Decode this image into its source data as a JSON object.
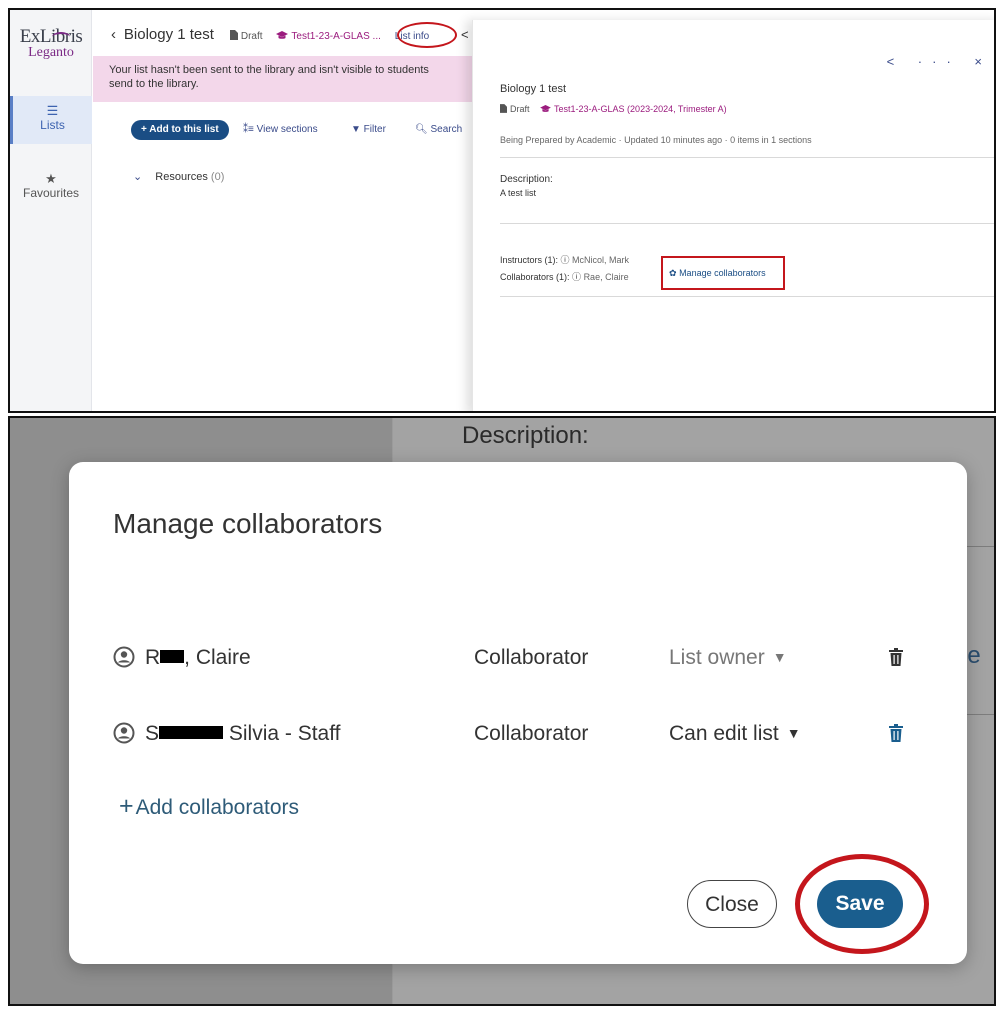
{
  "sidebar": {
    "logo_top": "ExLibris",
    "logo_bottom": "Leganto",
    "items": [
      {
        "icon": "list-icon",
        "glyph": "☰",
        "label": "Lists"
      },
      {
        "icon": "star-icon",
        "glyph": "★",
        "label": "Favourites"
      }
    ]
  },
  "header": {
    "back_glyph": "‹",
    "title": "Biology 1 test",
    "status": "Draft",
    "course": "Test1-23-A-GLAS ...",
    "list_info": "List info",
    "share_glyph": "<"
  },
  "banner": {
    "line1": "Your list hasn't been sent to the library and isn't visible to students",
    "line2": "send to the library."
  },
  "toolbar": {
    "add": "+ Add to this list",
    "view_sections": "⁑≡ View sections",
    "filter": "▼ Filter",
    "search": "🔍︎ Search"
  },
  "resources": {
    "label": "Resources",
    "count": "(0)"
  },
  "info_panel": {
    "actions": "< ··· ×",
    "title": "Biology 1 test",
    "status": "Draft",
    "course": "Test1-23-A-GLAS (2023-2024, Trimester A)",
    "meta": "Being Prepared by Academic  ·  Updated 10 minutes ago  ·  0 items in 1 sections",
    "description_label": "Description:",
    "description": "A test list",
    "instructors_label": "Instructors (1):",
    "instructor": "McNicol, Mark",
    "collaborators_label": "Collaborators (1):",
    "collaborator": "Rae, Claire",
    "manage_link": "Manage collaborators"
  },
  "background": {
    "description": "Description:",
    "snippet": "ge c"
  },
  "modal": {
    "title": "Manage collaborators",
    "rows": [
      {
        "name_prefix": "R",
        "name_suffix": ", Claire",
        "role": "Collaborator",
        "permission": "List owner",
        "trash_enabled": false
      },
      {
        "name_prefix": "S",
        "name_suffix": " Silvia - Staff",
        "role": "Collaborator",
        "permission": "Can edit list",
        "trash_enabled": true
      }
    ],
    "add_label": "Add collaborators",
    "close_label": "Close",
    "save_label": "Save"
  },
  "colors": {
    "brand_purple": "#7b2a86",
    "primary_blue": "#1a5e8e",
    "annotation_red": "#c4161c",
    "banner_pink": "#f3d7ea",
    "course_magenta": "#9b1c7e"
  }
}
